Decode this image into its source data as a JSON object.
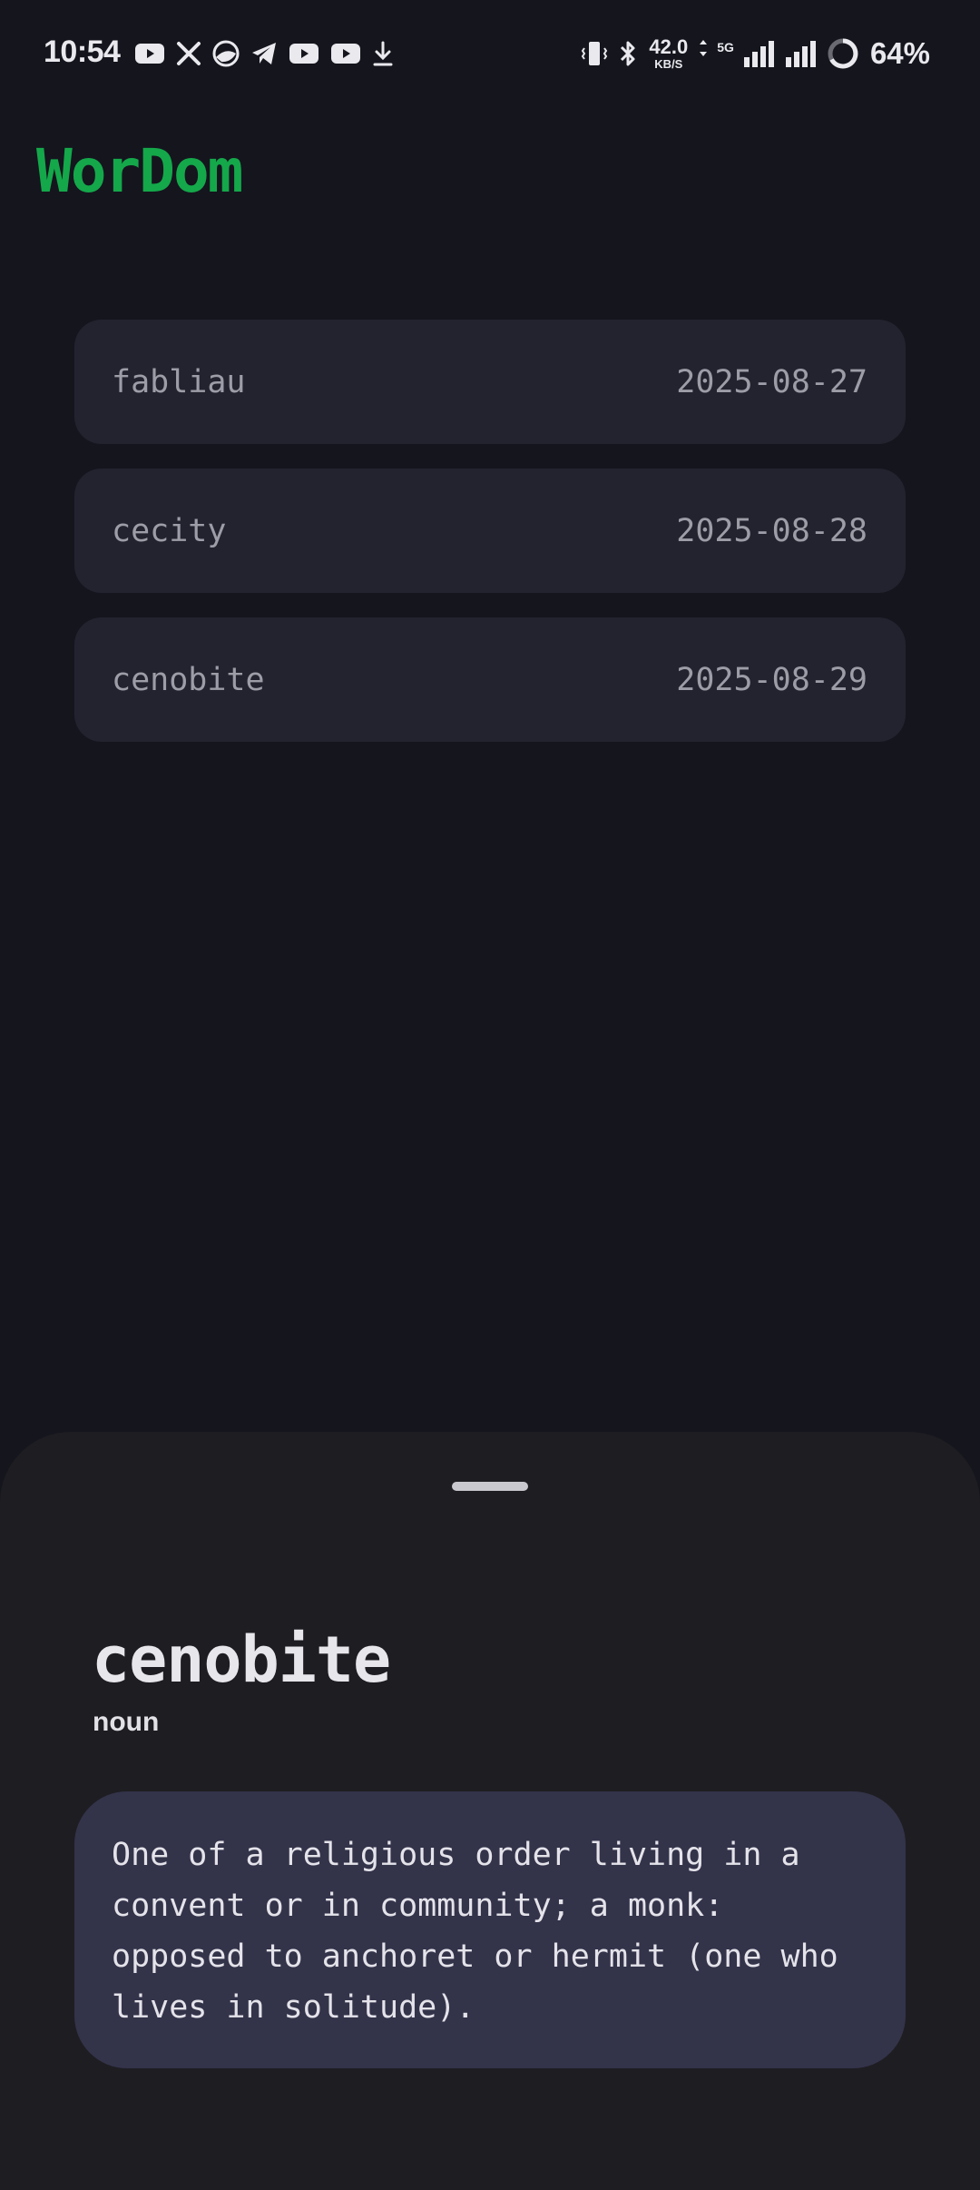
{
  "status_bar": {
    "time": "10:54",
    "left_icons": [
      "youtube-icon",
      "x-icon",
      "browser-icon",
      "telegram-icon",
      "youtube-icon",
      "youtube-icon",
      "download-icon"
    ],
    "net_speed_value": "42.0",
    "net_speed_unit": "KB/S",
    "network_type": "5G",
    "battery_percent": "64%"
  },
  "app": {
    "title": "WorDom",
    "accent_color": "#14a84a"
  },
  "word_list": [
    {
      "word": "fabliau",
      "date": "2025-08-27"
    },
    {
      "word": "cecity",
      "date": "2025-08-28"
    },
    {
      "word": "cenobite",
      "date": "2025-08-29"
    }
  ],
  "detail_sheet": {
    "word": "cenobite",
    "part_of_speech": "noun",
    "definition": "One of a religious order living in a convent or in community; a monk: opposed to anchoret or hermit (one who lives in solitude)."
  }
}
